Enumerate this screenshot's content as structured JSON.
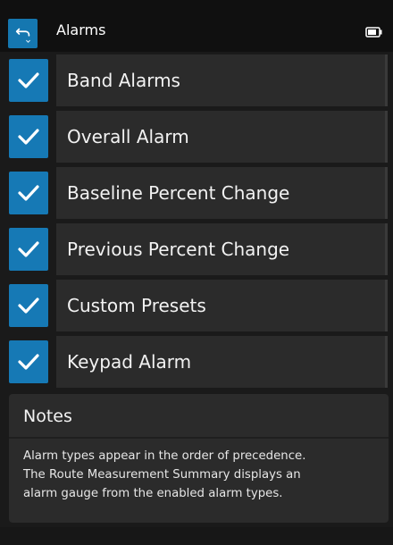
{
  "header": {
    "title": "Alarms",
    "back_icon": "back-arrow-icon",
    "battery_icon": "battery-icon",
    "accent": "#1679b5"
  },
  "alarms": [
    {
      "label": "Band Alarms",
      "checked": true
    },
    {
      "label": "Overall Alarm",
      "checked": true
    },
    {
      "label": "Baseline Percent Change",
      "checked": true
    },
    {
      "label": "Previous Percent Change",
      "checked": true
    },
    {
      "label": "Custom Presets",
      "checked": true
    },
    {
      "label": "Keypad Alarm",
      "checked": true
    }
  ],
  "notes": {
    "title": "Notes",
    "lines": [
      "Alarm types appear in the order of precedence.",
      "The Route Measurement Summary displays an",
      "alarm gauge from the enabled alarm types."
    ]
  }
}
